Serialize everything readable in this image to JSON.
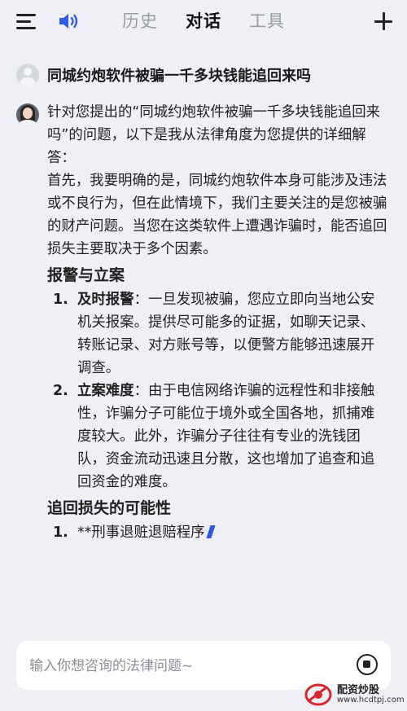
{
  "header": {
    "tabs": [
      {
        "label": "历史",
        "active": false
      },
      {
        "label": "对话",
        "active": true
      },
      {
        "label": "工具",
        "active": false
      }
    ],
    "accent_color": "#2f5be8"
  },
  "chat": {
    "user_question": "同城约炮软件被骗一千多块钱能追回来吗",
    "answer": {
      "intro": "针对您提出的“同城约炮软件被骗一千多块钱能追回来吗”的问题，以下是我从法律角度为您提供的详细解答：",
      "para1": "首先，我要明确的是，同城约炮软件本身可能涉及违法或不良行为，但在此情境下，我们主要关注的是您被骗的财产问题。当您在这类软件上遭遇诈骗时，能否追回损失主要取决于多个因素。",
      "section1_heading": "报警与立案",
      "section1_items": [
        {
          "num": "1.",
          "title": "及时报警",
          "text": "：一旦发现被骗，您应立即向当地公安机关报案。提供尽可能多的证据，如聊天记录、转账记录、对方账号等，以便警方能够迅速展开调查。"
        },
        {
          "num": "2.",
          "title": "立案难度",
          "text": "：由于电信网络诈骗的远程性和非接触性，诈骗分子可能位于境外或全国各地，抓捕难度较大。此外，诈骗分子往往有专业的洗钱团队，资金流动迅速且分散，这也增加了追查和追回资金的难度。"
        }
      ],
      "section2_heading": "追回损失的可能性",
      "section2_items": [
        {
          "num": "1.",
          "text": "**刑事退赃退赔程序"
        }
      ]
    }
  },
  "input": {
    "placeholder": "输入你想咨询的法律问题~"
  },
  "watermark": {
    "name": "配资炒股",
    "url": "www.hcdtpj.com"
  }
}
